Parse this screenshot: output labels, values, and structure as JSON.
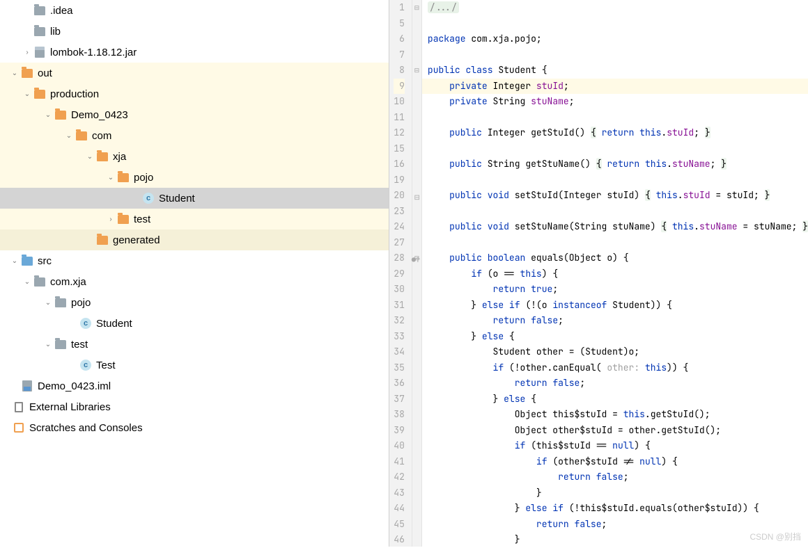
{
  "tree": [
    {
      "indent": 30,
      "arrow": "",
      "icon": "folder-gray",
      "label": ".idea",
      "hl": ""
    },
    {
      "indent": 30,
      "arrow": "",
      "icon": "folder-gray",
      "label": "lib",
      "hl": ""
    },
    {
      "indent": 30,
      "arrow": "›",
      "icon": "jar",
      "label": "lombok-1.18.12.jar",
      "hl": ""
    },
    {
      "indent": 12,
      "arrow": "⌄",
      "icon": "folder-orange",
      "label": "out",
      "hl": "hl"
    },
    {
      "indent": 30,
      "arrow": "⌄",
      "icon": "folder-orange",
      "label": "production",
      "hl": "hl"
    },
    {
      "indent": 60,
      "arrow": "⌄",
      "icon": "folder-orange",
      "label": "Demo_0423",
      "hl": "hl"
    },
    {
      "indent": 90,
      "arrow": "⌄",
      "icon": "folder-orange",
      "label": "com",
      "hl": "hl"
    },
    {
      "indent": 120,
      "arrow": "⌄",
      "icon": "folder-orange",
      "label": "xja",
      "hl": "hl"
    },
    {
      "indent": 150,
      "arrow": "⌄",
      "icon": "folder-orange",
      "label": "pojo",
      "hl": "hl"
    },
    {
      "indent": 186,
      "arrow": "",
      "icon": "class",
      "label": "Student",
      "hl": "selected"
    },
    {
      "indent": 150,
      "arrow": "›",
      "icon": "folder-orange",
      "label": "test",
      "hl": "hl"
    },
    {
      "indent": 120,
      "arrow": "",
      "icon": "folder-orange",
      "label": "generated",
      "hl": "hl2"
    },
    {
      "indent": 12,
      "arrow": "⌄",
      "icon": "folder-blue",
      "label": "src",
      "hl": ""
    },
    {
      "indent": 30,
      "arrow": "⌄",
      "icon": "folder-gray",
      "label": "com.xja",
      "hl": ""
    },
    {
      "indent": 60,
      "arrow": "⌄",
      "icon": "folder-gray",
      "label": "pojo",
      "hl": ""
    },
    {
      "indent": 96,
      "arrow": "",
      "icon": "class",
      "label": "Student",
      "hl": ""
    },
    {
      "indent": 60,
      "arrow": "⌄",
      "icon": "folder-gray",
      "label": "test",
      "hl": ""
    },
    {
      "indent": 96,
      "arrow": "",
      "icon": "class",
      "label": "Test",
      "hl": ""
    },
    {
      "indent": 12,
      "arrow": "",
      "icon": "iml",
      "label": "Demo_0423.iml",
      "hl": ""
    },
    {
      "indent": 0,
      "arrow": "",
      "icon": "lib",
      "label": "External Libraries",
      "hl": ""
    },
    {
      "indent": 0,
      "arrow": "",
      "icon": "scratch",
      "label": "Scratches and Consoles",
      "hl": ""
    }
  ],
  "firstLineNo": 1,
  "highlightedLineNo": 9,
  "gutterMarks": {
    "20": "⊟",
    "28": "●↑"
  },
  "code": [
    {
      "n": 1,
      "html": "<span class='cmt'>/.../</span>"
    },
    {
      "n": 5,
      "html": ""
    },
    {
      "n": 6,
      "html": "<span class='kw'>package</span> com.xja.pojo;"
    },
    {
      "n": 7,
      "html": ""
    },
    {
      "n": 8,
      "html": "<span class='kw'>public class</span> Student {"
    },
    {
      "n": 9,
      "hl": true,
      "html": "    <span class='kw'>private</span> Integer <span class='fld'>stuId</span>;"
    },
    {
      "n": 10,
      "html": "    <span class='kw'>private</span> String <span class='fld'>stuName</span>;"
    },
    {
      "n": 11,
      "html": ""
    },
    {
      "n": 12,
      "html": "    <span class='kw'>public</span> Integer getStuId() <span class='hlt'>{</span> <span class='kw'>return this</span>.<span class='fld'>stuId</span>; <span class='hlt'>}</span>"
    },
    {
      "n": 15,
      "html": ""
    },
    {
      "n": 16,
      "html": "    <span class='kw'>public</span> String getStuName() <span class='hlt'>{</span> <span class='kw'>return this</span>.<span class='fld'>stuName</span>; <span class='hlt'>}</span>"
    },
    {
      "n": 19,
      "html": ""
    },
    {
      "n": 20,
      "html": "    <span class='kw'>public void</span> setStuId(Integer stuId) <span class='hlt'>{</span> <span class='kw'>this</span>.<span class='fld'>stuId</span> = stuId; <span class='hlt'>}</span>"
    },
    {
      "n": 23,
      "html": ""
    },
    {
      "n": 24,
      "html": "    <span class='kw'>public void</span> setStuName(String stuName) <span class='hlt'>{</span> <span class='kw'>this</span>.<span class='fld'>stuName</span> = stuName; <span class='hlt'>}</span>"
    },
    {
      "n": 27,
      "html": ""
    },
    {
      "n": 28,
      "html": "    <span class='kw'>public boolean</span> equals(Object o) {"
    },
    {
      "n": 29,
      "html": "        <span class='kw'>if</span> (o == <span class='kw'>this</span>) {"
    },
    {
      "n": 30,
      "html": "            <span class='kw'>return true</span>;"
    },
    {
      "n": 31,
      "html": "        } <span class='kw'>else if</span> (!(o <span class='kw'>instanceof</span> Student)) {"
    },
    {
      "n": 32,
      "html": "            <span class='kw'>return false</span>;"
    },
    {
      "n": 33,
      "html": "        } <span class='kw'>else</span> {"
    },
    {
      "n": 34,
      "html": "            Student other = (Student)o;"
    },
    {
      "n": 35,
      "html": "            <span class='kw'>if</span> (!other.canEqual( <span style='color:#a0a0a0'>other:</span> <span class='kw'>this</span>)) {"
    },
    {
      "n": 36,
      "html": "                <span class='kw'>return false</span>;"
    },
    {
      "n": 37,
      "html": "            } <span class='kw'>else</span> {"
    },
    {
      "n": 38,
      "html": "                Object this$stuId = <span class='kw'>this</span>.getStuId();"
    },
    {
      "n": 39,
      "html": "                Object other$stuId = other.getStuId();"
    },
    {
      "n": 40,
      "html": "                <span class='kw'>if</span> (this$stuId == <span class='kw'>null</span>) {"
    },
    {
      "n": 41,
      "html": "                    <span class='kw'>if</span> (other$stuId != <span class='kw'>null</span>) {"
    },
    {
      "n": 42,
      "html": "                        <span class='kw'>return false</span>;"
    },
    {
      "n": 43,
      "html": "                    }"
    },
    {
      "n": 44,
      "html": "                } <span class='kw'>else if</span> (!this$stuId.equals(other$stuId)) {"
    },
    {
      "n": 45,
      "html": "                    <span class='kw'>return false</span>;"
    },
    {
      "n": 46,
      "html": "                }"
    }
  ],
  "watermark": "CSDN @别挡"
}
